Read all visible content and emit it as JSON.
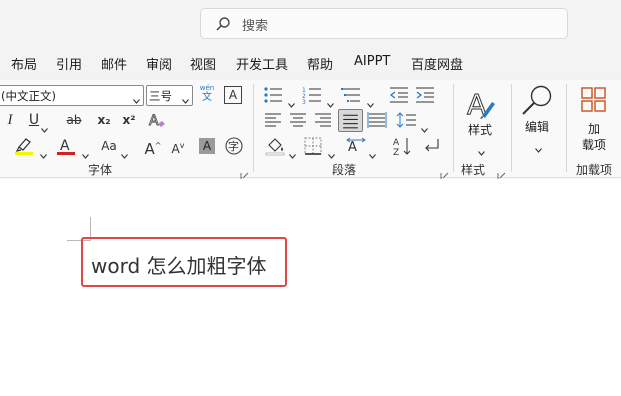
{
  "search": {
    "placeholder": "搜索"
  },
  "menu": [
    "布局",
    "引用",
    "邮件",
    "审阅",
    "视图",
    "开发工具",
    "帮助",
    "AIPPT",
    "百度网盘"
  ],
  "font_group": {
    "font_name": "(中文正文)",
    "font_size": "三号",
    "phonetic_top": "wén",
    "phonetic_bottom": "文",
    "char_border": "A",
    "italic": "I",
    "underline": "U",
    "strike": "ab",
    "subscript": "x₂",
    "superscript": "x²",
    "change_case": "Aa",
    "grow": "A",
    "shrink": "A",
    "shading": "A",
    "enclose": "字",
    "label": "字体",
    "highlight_color": "#f5f500",
    "font_color": "#d42020"
  },
  "paragraph_group": {
    "label": "段落"
  },
  "styles_group": {
    "button_label": "样式",
    "label": "样式"
  },
  "editing_group": {
    "button_label": "编辑"
  },
  "addins_group": {
    "button_label_line1": "加",
    "button_label_line2": "载项",
    "label": "加载项"
  },
  "document": {
    "highlighted_text": "word 怎么加粗字体"
  }
}
